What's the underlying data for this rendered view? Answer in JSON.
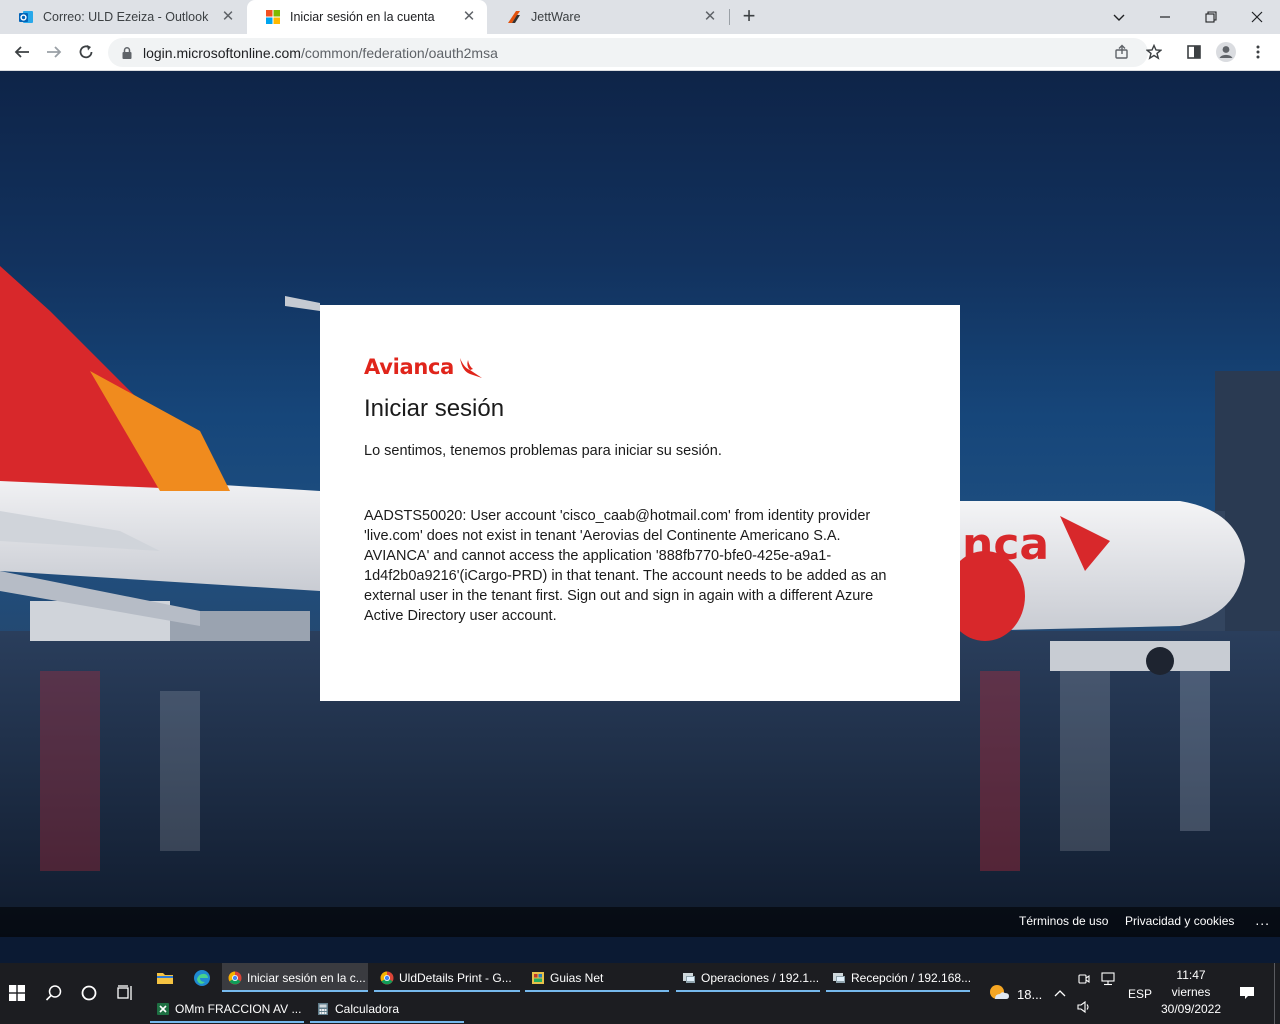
{
  "browser": {
    "tabs": [
      {
        "label": "Correo: ULD Ezeiza - Outlook",
        "icon": "outlook-icon"
      },
      {
        "label": "Iniciar sesión en la cuenta",
        "icon": "microsoft-icon"
      },
      {
        "label": "JettWare",
        "icon": "jettware-icon"
      }
    ],
    "url_host": "login.microsoftonline.com",
    "url_path": "/common/federation/oauth2msa"
  },
  "card": {
    "brand": "Avianca",
    "title": "Iniciar sesión",
    "message": "Lo sentimos, tenemos problemas para iniciar su sesión.",
    "error": "AADSTS50020: User account 'cisco_caab@hotmail.com' from identity provider 'live.com' does not exist in tenant 'Aerovias del Continente Americano S.A. AVIANCA' and cannot access the application '888fb770-bfe0-425e-a9a1-1d4f2b0a9216'(iCargo-PRD) in that tenant. The account needs to be added as an external user in the tenant first. Sign out and sign in again with a different Azure Active Directory user account."
  },
  "footer": {
    "terms": "Términos de uso",
    "privacy": "Privacidad y cookies",
    "more": "..."
  },
  "taskbar": {
    "tasks_row1": [
      {
        "label": "Iniciar sesión en la c...",
        "icon": "chrome-icon"
      },
      {
        "label": "UldDetails Print - G...",
        "icon": "chrome-icon"
      },
      {
        "label": "Guias Net",
        "icon": "app-icon"
      },
      {
        "label": "Operaciones / 192.1...",
        "icon": "remote-desktop-icon"
      },
      {
        "label": "Recepción / 192.168....",
        "icon": "remote-desktop-icon"
      }
    ],
    "tasks_row2": [
      {
        "label": "OMm FRACCION AV ...",
        "icon": "excel-icon"
      },
      {
        "label": "Calculadora",
        "icon": "calculator-icon"
      }
    ],
    "weather": "18...",
    "language": "ESP",
    "time": "11:47",
    "day": "viernes",
    "date": "30/09/2022"
  }
}
